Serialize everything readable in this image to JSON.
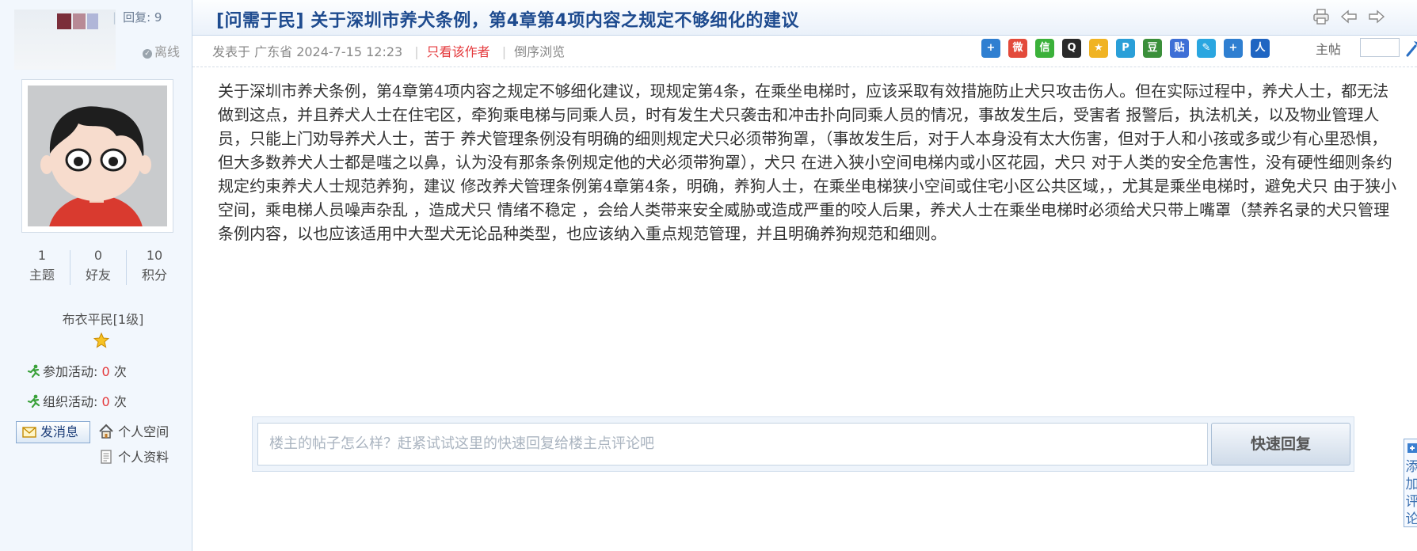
{
  "thread": {
    "reply_label": "回复:",
    "reply_count": "9",
    "title_tag": "[问需于民]",
    "title": "关于深圳市养犬条例，第4章第4项内容之规定不够细化的建议"
  },
  "author": {
    "status": "离线",
    "stats": [
      {
        "value": "1",
        "label": "主题"
      },
      {
        "value": "0",
        "label": "好友"
      },
      {
        "value": "10",
        "label": "积分"
      }
    ],
    "level": "布衣平民[1级]",
    "activities": [
      {
        "label": "参加活动:",
        "count": "0",
        "unit": "次"
      },
      {
        "label": "组织活动:",
        "count": "0",
        "unit": "次"
      }
    ],
    "send_message": "发消息",
    "personal_space": "个人空间",
    "personal_profile": "个人资料"
  },
  "meta": {
    "posted_prefix": "发表于 广东省",
    "datetime": "2024-7-15 12:23",
    "author_only": "只看该作者",
    "reverse_order": "倒序浏览",
    "floor_label": "主帖",
    "share_icons": [
      {
        "icon": "plus-share-icon",
        "glyph": "+",
        "color": "#2f7fd1"
      },
      {
        "icon": "weibo-icon",
        "glyph": "微",
        "color": "#e34a3b"
      },
      {
        "icon": "wechat-icon",
        "glyph": "信",
        "color": "#3bb13a"
      },
      {
        "icon": "qq-icon",
        "glyph": "Q",
        "color": "#2a2a2a"
      },
      {
        "icon": "qzone-icon",
        "glyph": "★",
        "color": "#f0b323"
      },
      {
        "icon": "tencent-weibo-icon",
        "glyph": "P",
        "color": "#2a9fd8"
      },
      {
        "icon": "douban-icon",
        "glyph": "豆",
        "color": "#3a8f3a"
      },
      {
        "icon": "tieba-icon",
        "glyph": "贴",
        "color": "#3e6fd6"
      },
      {
        "icon": "note-icon",
        "glyph": "✎",
        "color": "#2aa6e0"
      },
      {
        "icon": "more-share-icon",
        "glyph": "+",
        "color": "#2f7fd1"
      },
      {
        "icon": "renren-icon",
        "glyph": "人",
        "color": "#1f65c2"
      }
    ]
  },
  "post": {
    "body": "关于深圳市养犬条例，第4章第4项内容之规定不够细化建议，现规定第4条，在乘坐电梯时，应该采取有效措施防止犬只攻击伤人。但在实际过程中，养犬人士，都无法做到这点，并且养犬人士在住宅区，牵狗乘电梯与同乘人员，时有发生犬只袭击和冲击扑向同乘人员的情况，事故发生后，受害者 报警后，执法机关，以及物业管理人员，只能上门劝导养犬人士，苦于 养犬管理条例没有明确的细则规定犬只必须带狗罩，（事故发生后，对于人本身没有太大伤害，但对于人和小孩或多或少有心里恐惧，但大多数养犬人士都是嗤之以鼻，认为没有那条条例规定他的犬必须带狗罩），犬只 在进入狭小空间电梯内或小区花园，犬只 对于人类的安全危害性，没有硬性细则条约规定约束养犬人士规范养狗，建议 修改养犬管理条例第4章第4条，明确，养狗人士，在乘坐电梯狭小空间或住宅小区公共区域，，尤其是乘坐电梯时，避免犬只 由于狭小空间，乘电梯人员噪声杂乱 ，造成犬只 情绪不稳定 ，会给人类带来安全威胁或造成严重的咬人后果，养犬人士在乘坐电梯时必须给犬只带上嘴罩（禁养名录的犬只管理条例内容，以也应该适用中大型犬无论品种类型，也应该纳入重点规范管理，并且明确养狗规范和细则。"
  },
  "quick_reply": {
    "placeholder": "楼主的帖子怎么样？赶紧试试这里的快速回复给楼主点评论吧",
    "button": "快速回复"
  },
  "side_tab": {
    "text": "添加评论"
  }
}
